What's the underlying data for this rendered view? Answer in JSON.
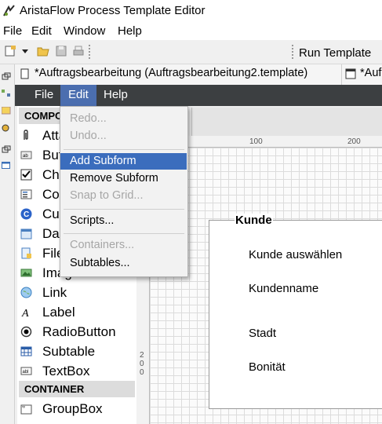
{
  "window": {
    "title": "AristaFlow Process Template Editor"
  },
  "outer_menu": [
    "File",
    "Edit",
    "Window",
    "Help"
  ],
  "toolbar": {
    "run_template": "Run Template"
  },
  "tabs": [
    {
      "label": "*Auftragsbearbeitung (Auftragsbearbeitung2.template)"
    },
    {
      "label": "*Auf"
    }
  ],
  "inner_menu": [
    "File",
    "Edit",
    "Help"
  ],
  "components": {
    "header": "COMPO",
    "items": [
      {
        "label": "Atta",
        "icon": "paperclip-icon"
      },
      {
        "label": "Butt",
        "icon": "button-icon"
      },
      {
        "label": "Che",
        "icon": "checkbox-icon"
      },
      {
        "label": "Com",
        "icon": "combobox-icon"
      },
      {
        "label": "Cust",
        "icon": "custom-c-icon"
      },
      {
        "label": "Dat",
        "icon": "date-icon"
      },
      {
        "label": "File",
        "icon": "file-icon"
      },
      {
        "label": "Image",
        "icon": "image-icon"
      },
      {
        "label": "Link",
        "icon": "globe-icon"
      },
      {
        "label": "Label",
        "icon": "italic-a-icon"
      },
      {
        "label": "RadioButton",
        "icon": "radio-icon"
      },
      {
        "label": "Subtable",
        "icon": "table-icon"
      },
      {
        "label": "TextBox",
        "icon": "textbox-icon"
      }
    ],
    "container_header": "CONTAINER",
    "container_items": [
      {
        "label": "GroupBox",
        "icon": "groupbox-icon"
      }
    ]
  },
  "edit_menu": {
    "items": [
      {
        "label": "Redo...",
        "enabled": false
      },
      {
        "label": "Undo...",
        "enabled": false
      },
      {
        "label": "Add Subform",
        "enabled": true,
        "highlighted": true
      },
      {
        "label": "Remove Subform",
        "enabled": true
      },
      {
        "label": "Snap to Grid...",
        "enabled": false
      },
      {
        "label": "Scripts...",
        "enabled": true
      },
      {
        "label": "Containers...",
        "enabled": false
      },
      {
        "label": "Subtables...",
        "enabled": true
      }
    ]
  },
  "ruler": {
    "top": [
      "100",
      "200"
    ],
    "left": [
      "2",
      "0",
      "0"
    ]
  },
  "form": {
    "title": "Kunde",
    "fields": [
      "Kunde auswählen",
      "Kundenname",
      "Stadt",
      "Bonität"
    ]
  },
  "colors": {
    "menubar_dark": "#3c3f41",
    "highlight": "#3b6dbd"
  }
}
